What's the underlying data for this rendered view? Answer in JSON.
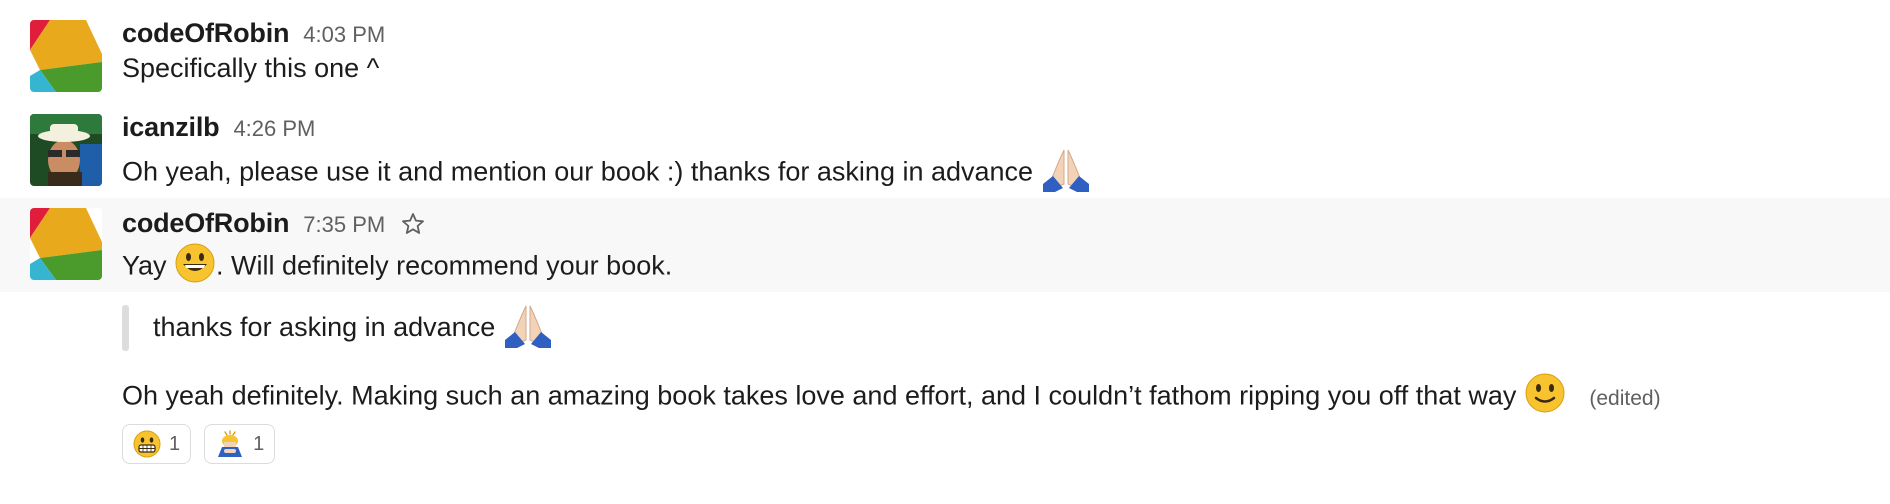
{
  "messages": [
    {
      "author": "codeOfRobin",
      "time": "4:03 PM",
      "text": "Specifically this one ^"
    },
    {
      "author": "icanzilb",
      "time": "4:26 PM",
      "text": "Oh yeah, please use it and mention our book :) thanks for asking in advance",
      "trailing_emoji": "folded-hands"
    },
    {
      "author": "codeOfRobin",
      "time": "7:35 PM",
      "text_before": "Yay",
      "inline_emoji": "grinning-face",
      "text_after": ". Will definitely recommend your book.",
      "quote": {
        "text": "thanks for asking in advance",
        "emoji": "folded-hands"
      },
      "followup": {
        "text": "Oh yeah definitely. Making such an amazing book takes love and effort, and I couldn’t  fathom ripping you off that way",
        "emoji": "slightly-smiling-face",
        "edited_label": "(edited)"
      },
      "reactions": [
        {
          "emoji": "grimacing-face",
          "count": "1"
        },
        {
          "emoji": "person-bowing",
          "count": "1"
        }
      ]
    }
  ],
  "colors": {
    "highlight_bg": "#f8f8f8",
    "muted_text": "#616061",
    "avatar_robin": [
      "#e01e3c",
      "#e8a91d",
      "#4a9a2c",
      "#36b5d0"
    ]
  }
}
